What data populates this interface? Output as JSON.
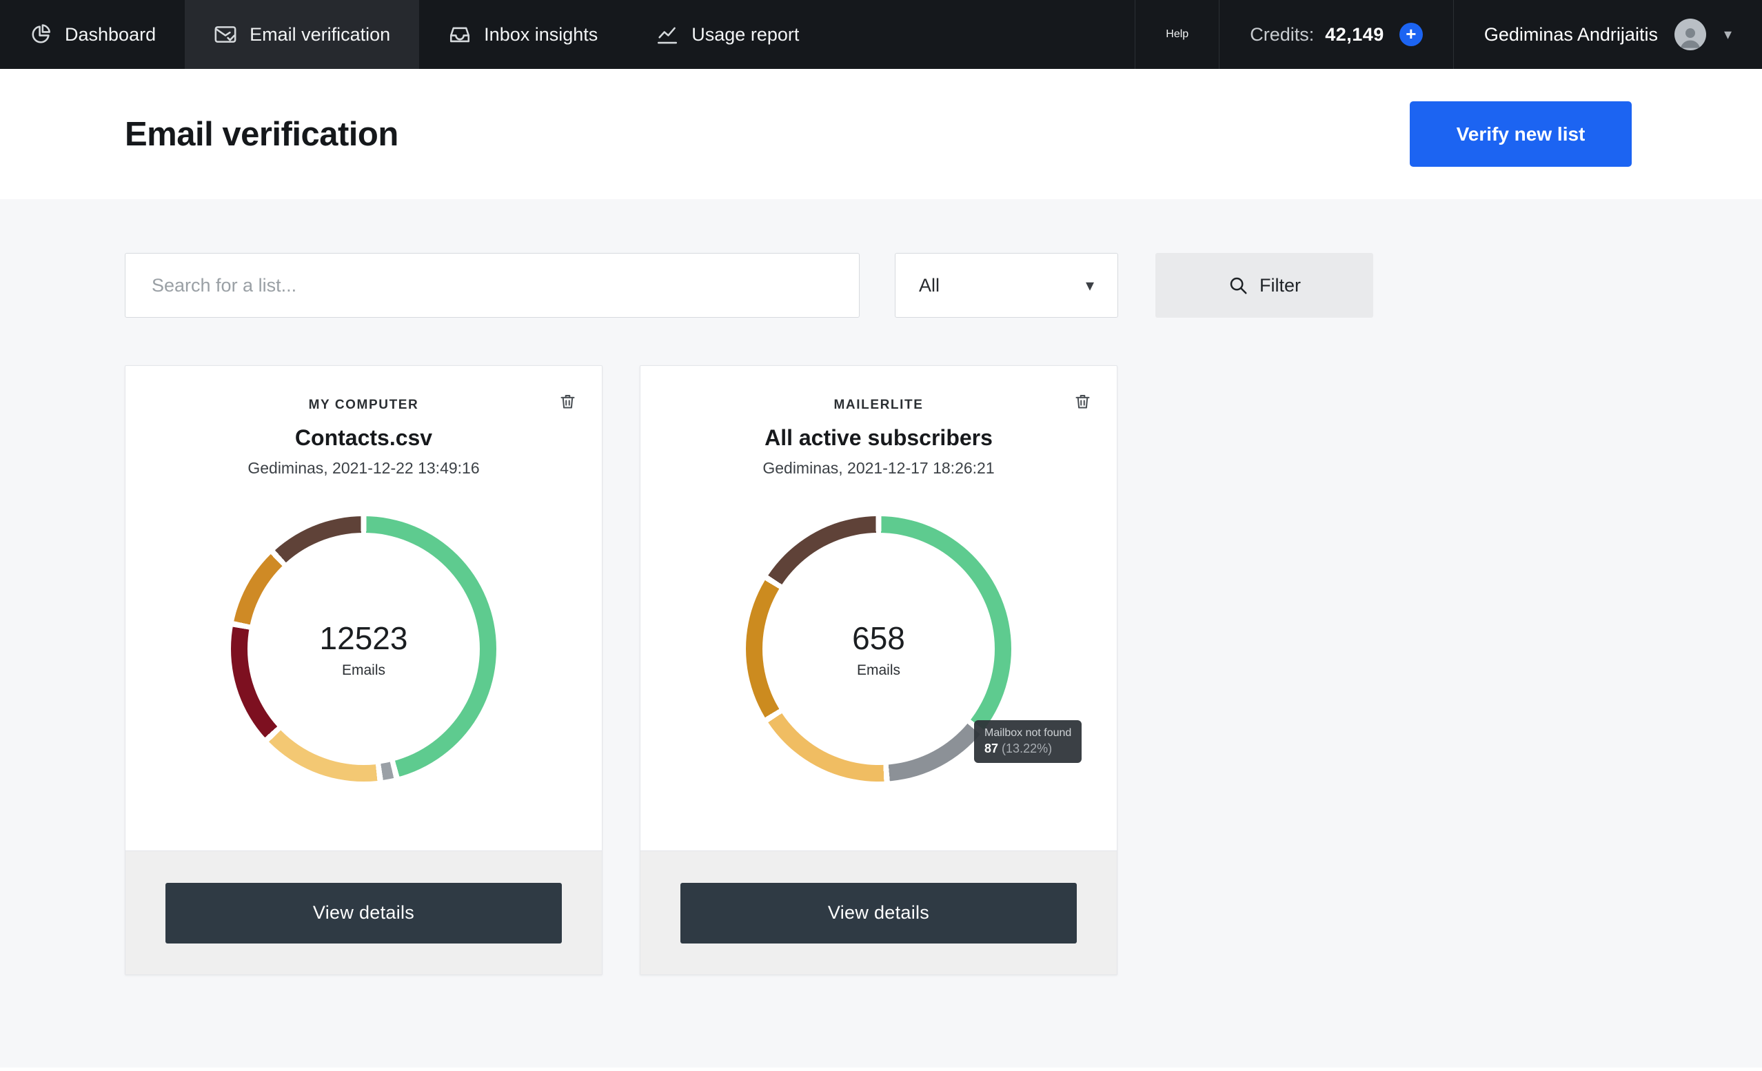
{
  "nav": {
    "items": [
      {
        "label": "Dashboard"
      },
      {
        "label": "Email verification"
      },
      {
        "label": "Inbox insights"
      },
      {
        "label": "Usage report"
      }
    ],
    "help_label": "Help",
    "credits_label": "Credits:",
    "credits_value": "42,149",
    "user_name": "Gediminas Andrijaitis"
  },
  "icons": {
    "plus": "+",
    "caret_down": "▾"
  },
  "header": {
    "title": "Email verification",
    "verify_button": "Verify new list"
  },
  "filters": {
    "search_placeholder": "Search for a list...",
    "dropdown_value": "All",
    "filter_button": "Filter"
  },
  "cards": [
    {
      "source": "MY COMPUTER",
      "title": "Contacts.csv",
      "meta": "Gediminas, 2021-12-22 13:49:16",
      "emails_count": "12523",
      "emails_label": "Emails",
      "view_details": "View details"
    },
    {
      "source": "MAILERLITE",
      "title": "All active subscribers",
      "meta": "Gediminas, 2021-12-17 18:26:21",
      "emails_count": "658",
      "emails_label": "Emails",
      "view_details": "View details",
      "tooltip": {
        "label": "Mailbox not found",
        "value": "87",
        "pct": "(13.22%)"
      }
    }
  ],
  "chart_data": [
    {
      "type": "pie",
      "title": "Contacts.csv",
      "center_value": 12523,
      "center_label": "Emails",
      "segments": [
        {
          "name": "green",
          "color": "#5ecb8f",
          "pct": 46
        },
        {
          "name": "gray",
          "color": "#9aa0a6",
          "pct": 2
        },
        {
          "name": "yellow",
          "color": "#f3c873",
          "pct": 15
        },
        {
          "name": "dark-red",
          "color": "#7d1020",
          "pct": 15
        },
        {
          "name": "orange",
          "color": "#cf8a25",
          "pct": 10
        },
        {
          "name": "brown",
          "color": "#5f4238",
          "pct": 12
        }
      ]
    },
    {
      "type": "pie",
      "title": "All active subscribers",
      "center_value": 658,
      "center_label": "Emails",
      "segments": [
        {
          "name": "green",
          "color": "#5ecb8f",
          "pct": 35.78
        },
        {
          "name": "mailbox-not-found-gray",
          "color": "#8c9197",
          "pct": 13.22
        },
        {
          "name": "yellow",
          "color": "#f0bd62",
          "pct": 17
        },
        {
          "name": "orange",
          "color": "#cc8b1f",
          "pct": 18
        },
        {
          "name": "brown",
          "color": "#5f4238",
          "pct": 16
        }
      ]
    }
  ]
}
